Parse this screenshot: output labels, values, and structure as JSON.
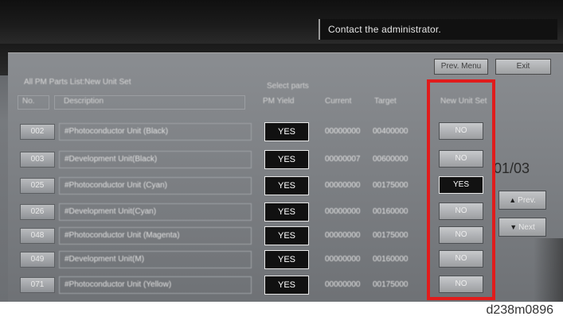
{
  "header": {
    "admin_message": "Contact the administrator."
  },
  "toolbar": {
    "prev_menu": "Prev. Menu",
    "exit": "Exit"
  },
  "list": {
    "title": "All PM Parts List:New Unit Set",
    "select_parts": "Select parts",
    "columns": {
      "no": "No.",
      "description": "Description",
      "pm_yield": "PM Yield",
      "current": "Current",
      "target": "Target",
      "new_unit_set": "New Unit Set"
    },
    "rows": [
      {
        "no": "002",
        "description": "#Photoconductor Unit (Black)",
        "pm_yield": "YES",
        "current": "00000000",
        "target": "00400000",
        "new_unit": "NO"
      },
      {
        "no": "003",
        "description": "#Development Unit(Black)",
        "pm_yield": "YES",
        "current": "00000007",
        "target": "00600000",
        "new_unit": "NO"
      },
      {
        "no": "025",
        "description": "#Photoconductor Unit (Cyan)",
        "pm_yield": "YES",
        "current": "00000000",
        "target": "00175000",
        "new_unit": "YES"
      },
      {
        "no": "026",
        "description": "#Development Unit(Cyan)",
        "pm_yield": "YES",
        "current": "00000000",
        "target": "00160000",
        "new_unit": "NO"
      },
      {
        "no": "048",
        "description": "#Photoconductor Unit (Magenta)",
        "pm_yield": "YES",
        "current": "00000000",
        "target": "00175000",
        "new_unit": "NO"
      },
      {
        "no": "049",
        "description": "#Development Unit(M)",
        "pm_yield": "YES",
        "current": "00000000",
        "target": "00160000",
        "new_unit": "NO"
      },
      {
        "no": "071",
        "description": "#Photoconductor Unit (Yellow)",
        "pm_yield": "YES",
        "current": "00000000",
        "target": "00175000",
        "new_unit": "NO"
      }
    ]
  },
  "pagination": {
    "page": "01/03",
    "prev": "Prev.",
    "next": "Next"
  },
  "caption": "d238m0896",
  "colors": {
    "highlight": "#e01c1c",
    "selected": "#111111"
  }
}
